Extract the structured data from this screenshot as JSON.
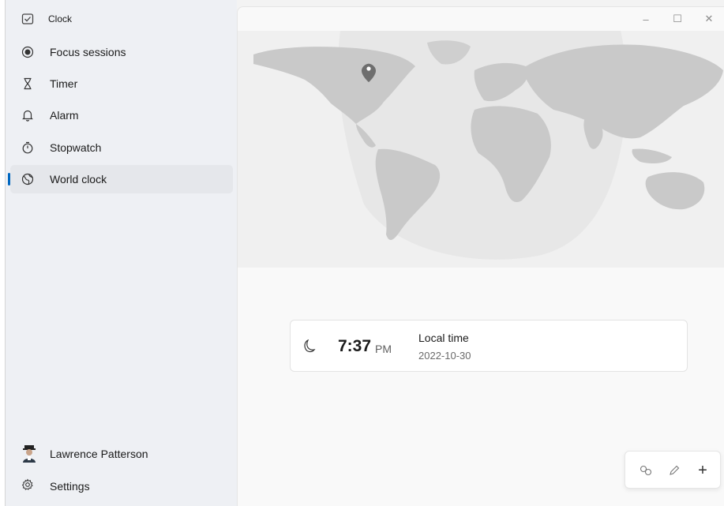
{
  "app": {
    "title": "Clock"
  },
  "window_controls": {
    "minimize": "–",
    "maximize": "☐",
    "close": "✕"
  },
  "nav": [
    {
      "label": "Focus sessions",
      "icon": "focus-icon",
      "selected": false
    },
    {
      "label": "Timer",
      "icon": "hourglass-icon",
      "selected": false
    },
    {
      "label": "Alarm",
      "icon": "bell-icon",
      "selected": false
    },
    {
      "label": "Stopwatch",
      "icon": "stopwatch-icon",
      "selected": false
    },
    {
      "label": "World clock",
      "icon": "globe-icon",
      "selected": true
    }
  ],
  "user": {
    "name": "Lawrence Patterson"
  },
  "settings": {
    "label": "Settings"
  },
  "world_clock": {
    "time": "7:37",
    "ampm": "PM",
    "location": "Local time",
    "date": "2022-10-30"
  },
  "toolbar": {
    "compare_icon": "compare-icon",
    "edit_icon": "pencil-icon",
    "add_label": "+"
  },
  "colors": {
    "accent": "#0067c0",
    "sidebar": "#eef0f4",
    "land": "#c9c9c9",
    "night": "#e8e8e8"
  }
}
